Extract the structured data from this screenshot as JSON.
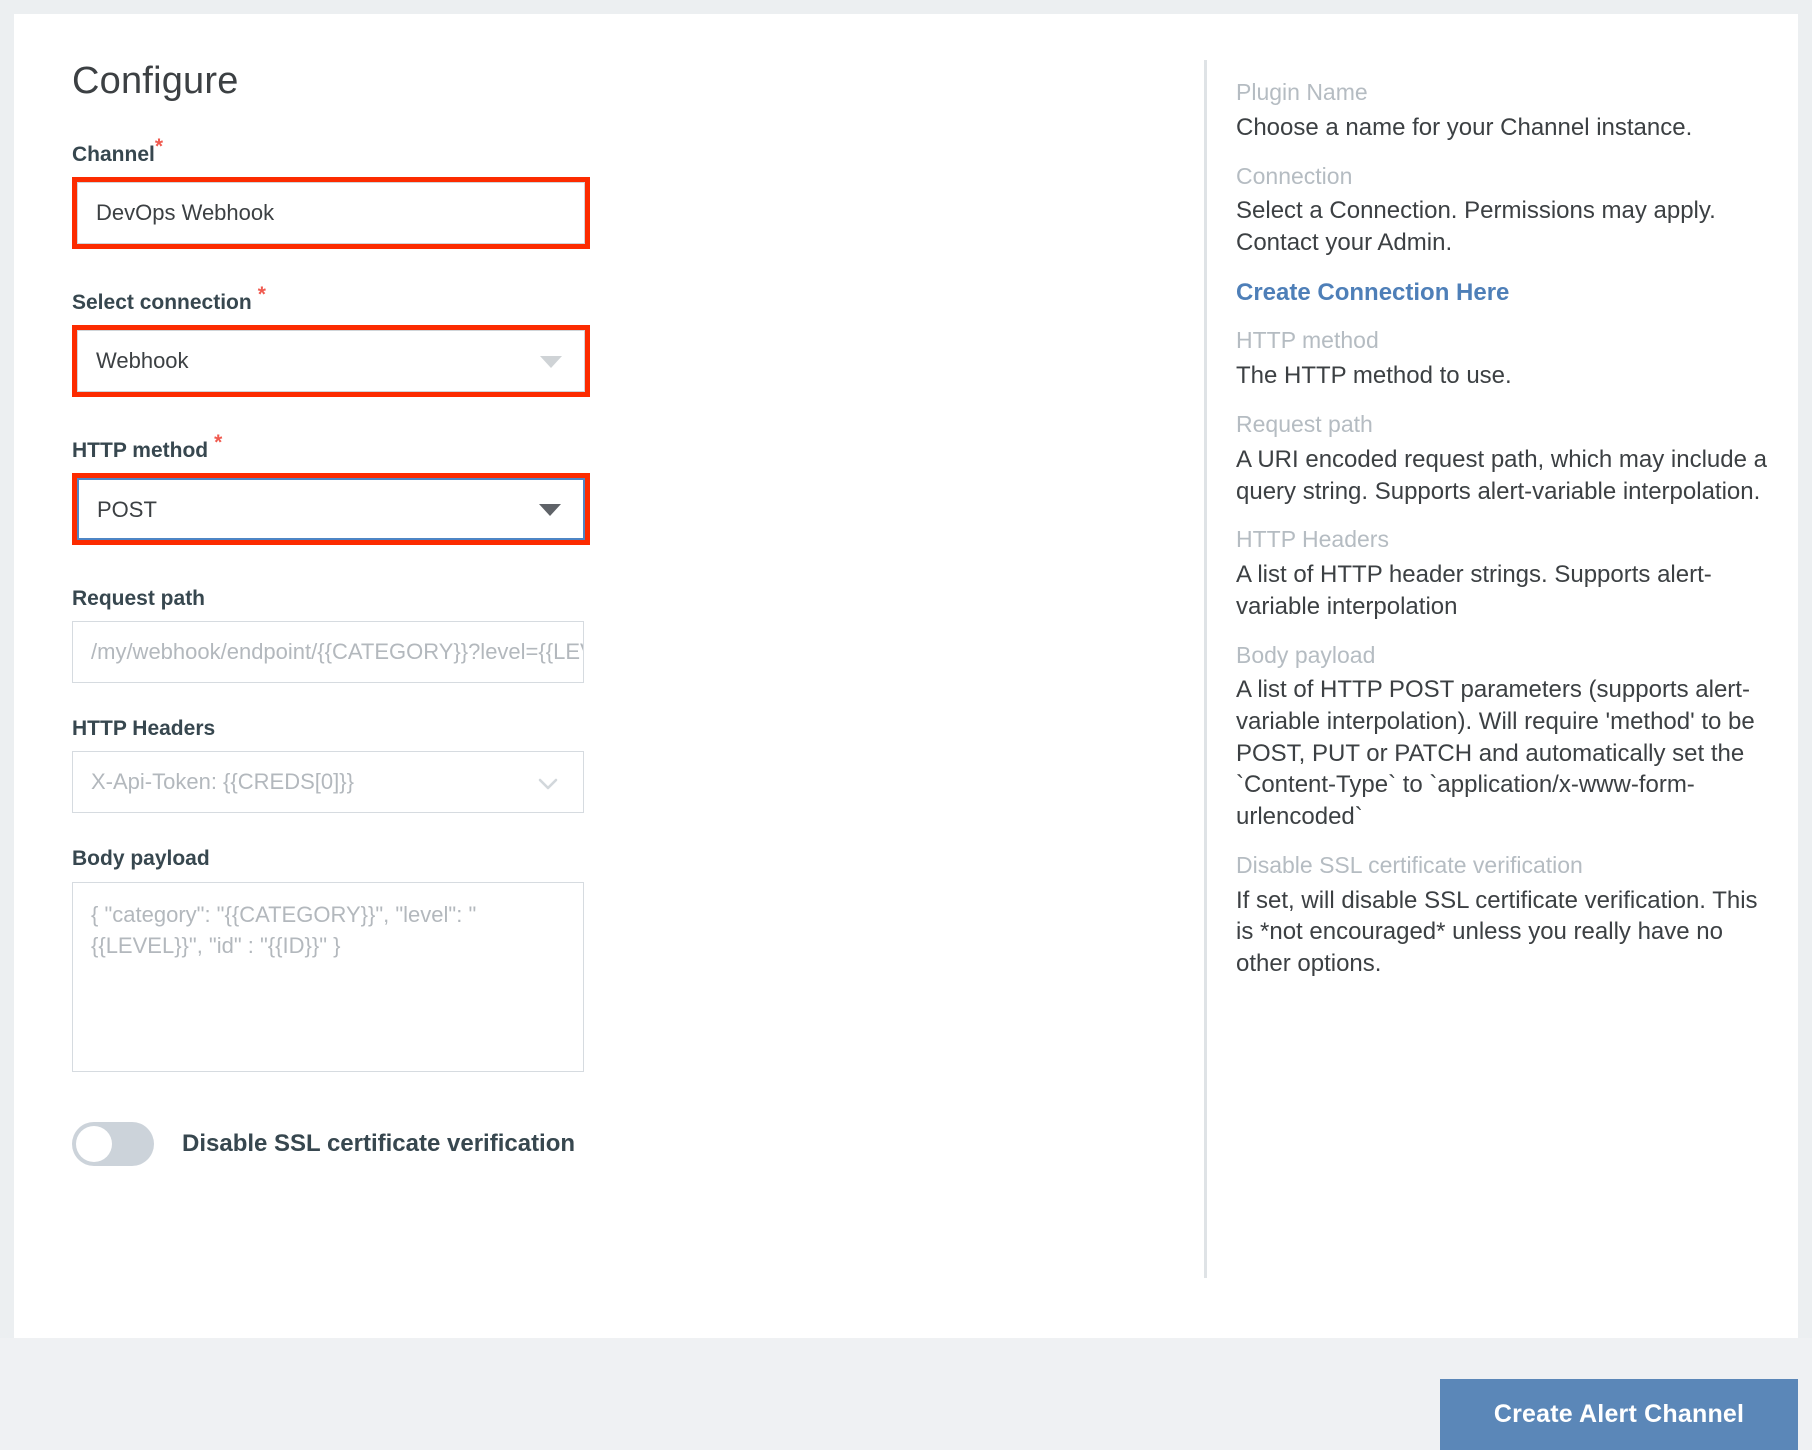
{
  "form": {
    "title": "Configure",
    "channel": {
      "label": "Channel",
      "required_marker": "*",
      "value": "DevOps Webhook",
      "highlighted": true
    },
    "connection": {
      "label": "Select connection",
      "required_marker": "*",
      "value": "Webhook",
      "dropdown_icon": "triangle-down-icon",
      "highlighted": true
    },
    "http_method": {
      "label": "HTTP method",
      "required_marker": "*",
      "value": "POST",
      "dropdown_icon": "triangle-down-icon",
      "highlighted": true,
      "focused": true
    },
    "request_path": {
      "label": "Request path",
      "placeholder": "/my/webhook/endpoint/{{CATEGORY}}?level={{LEVEL}}"
    },
    "http_headers": {
      "label": "HTTP Headers",
      "placeholder": "X-Api-Token: {{CREDS[0]}}",
      "dropdown_icon": "chevron-down-icon"
    },
    "body_payload": {
      "label": "Body payload",
      "placeholder": "{ \"category\": \"{{CATEGORY}}\", \"level\": \" {{LEVEL}}\", \"id\" : \"{{ID}}\" }"
    },
    "disable_ssl": {
      "label": "Disable SSL certificate verification",
      "state": "off"
    }
  },
  "help": {
    "entries": [
      {
        "term": "Plugin Name",
        "definition": "Choose a name for your Channel instance."
      },
      {
        "term": "Connection",
        "definition": "Select a Connection. Permissions may apply. Contact your Admin.",
        "link": "Create Connection Here"
      },
      {
        "term": "HTTP method",
        "definition": "The HTTP method to use."
      },
      {
        "term": "Request path",
        "definition": "A URI encoded request path, which may include a query string. Supports alert-variable interpolation."
      },
      {
        "term": "HTTP Headers",
        "definition": "A list of HTTP header strings. Supports alert-variable interpolation"
      },
      {
        "term": "Body payload",
        "definition": "A list of HTTP POST parameters (supports alert-variable interpolation). Will require 'method' to be POST, PUT or PATCH and automatically set the `Content-Type` to `application/x-www-form-urlencoded`"
      },
      {
        "term": "Disable SSL certificate verification",
        "definition": "If set, will disable SSL certificate verification. This is *not encouraged* unless you really have no other options."
      }
    ]
  },
  "footer": {
    "submit_label": "Create Alert Channel"
  },
  "colors": {
    "highlight": "#fc2b00",
    "primary_button": "#5b87b8",
    "link": "#4e7fb8",
    "required_star": "#f05a4f",
    "focus_border": "#4e85c5"
  }
}
